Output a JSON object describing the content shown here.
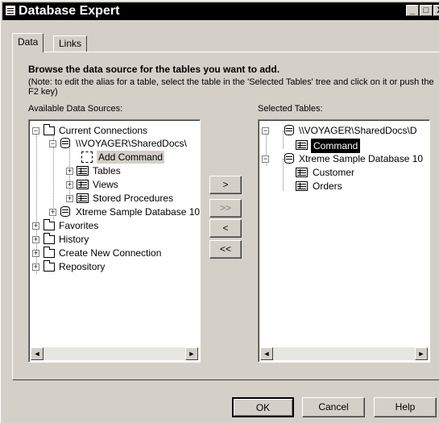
{
  "window": {
    "title": "Database Expert",
    "controls": [
      "_",
      "□",
      "X"
    ]
  },
  "tabs": [
    {
      "label": "Data",
      "active": true
    },
    {
      "label": "Links",
      "active": false
    }
  ],
  "panel": {
    "heading": "Browse the data source for the tables you want to add.",
    "note": "(Note: to edit the alias for a table, select the table in the 'Selected Tables' tree and click on it or push the F2 key)"
  },
  "available": {
    "label": "Available Data Sources:",
    "tree": {
      "current_connections": "Current Connections",
      "voyager": "\\\\VOYAGER\\SharedDocs\\",
      "add_command": "Add Command",
      "tables": "Tables",
      "views": "Views",
      "stored_procedures": "Stored Procedures",
      "xtreme": "Xtreme Sample Database 10",
      "favorites": "Favorites",
      "history": "History",
      "create_new_connection": "Create New Connection",
      "repository": "Repository"
    }
  },
  "selected": {
    "label": "Selected Tables:",
    "tree": {
      "voyager": "\\\\VOYAGER\\SharedDocs\\D",
      "command": "Command",
      "xtreme": "Xtreme Sample Database 10",
      "customer": "Customer",
      "orders": "Orders"
    }
  },
  "transfer_buttons": {
    "add": ">",
    "add_all": ">>",
    "remove": "<",
    "remove_all": "<<"
  },
  "footer": {
    "ok": "OK",
    "cancel": "Cancel",
    "help": "Help"
  },
  "scroll_arrows": {
    "left": "◄",
    "right": "►"
  },
  "expanders": {
    "plus": "+",
    "minus": "−"
  },
  "colors": {
    "dialog_bg": "#d4d0c8",
    "titlebar": "#000000",
    "selection": "#000000"
  }
}
